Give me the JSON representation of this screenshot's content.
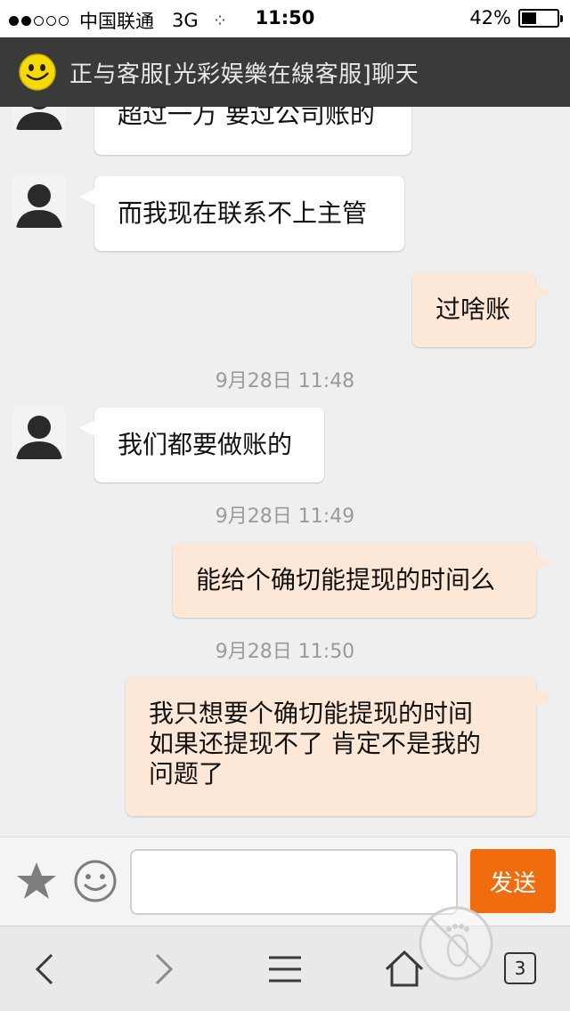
{
  "status_bar": {
    "carrier": "中国联通",
    "network": "3G",
    "time": "11:50",
    "battery": "42%",
    "battery_level": 0.42
  },
  "header": {
    "title": "正与客服[光彩娱樂在線客服]聊天",
    "icon": "smiley-icon"
  },
  "messages": [
    {
      "side": "in",
      "lines": [
        "超过一万 要过公司账的"
      ]
    },
    {
      "side": "in",
      "lines": [
        "而我现在联系不上主管"
      ]
    },
    {
      "side": "out",
      "lines": [
        "过啥账"
      ]
    },
    {
      "type": "timestamp",
      "text": "9月28日 11:48"
    },
    {
      "side": "in",
      "lines": [
        "我们都要做账的"
      ]
    },
    {
      "type": "timestamp",
      "text": "9月28日 11:49"
    },
    {
      "side": "out",
      "lines": [
        "能给个确切能提现的时间么"
      ]
    },
    {
      "type": "timestamp",
      "text": "9月28日 11:50"
    },
    {
      "side": "out",
      "lines": [
        "我只想要个确切能提现的时间",
        "如果还提现不了 肯定不是我的",
        "问题了"
      ]
    }
  ],
  "input_bar": {
    "favorite_icon": "star-icon",
    "emoji_icon": "smiley-face-icon",
    "message_value": "",
    "send_label": "发送"
  },
  "browser_toolbar": {
    "back_icon": "chevron-left-icon",
    "forward_icon": "chevron-right-icon",
    "menu_icon": "menu-icon",
    "home_icon": "home-icon",
    "footprint_icon": "footprint-icon",
    "tab_count": "3"
  },
  "colors": {
    "title_bar": "#3a3a3a",
    "incoming_bubble": "#ffffff",
    "outgoing_bubble": "#fde8d8",
    "send_button": "#f06d0f",
    "chat_background": "#efefef"
  }
}
